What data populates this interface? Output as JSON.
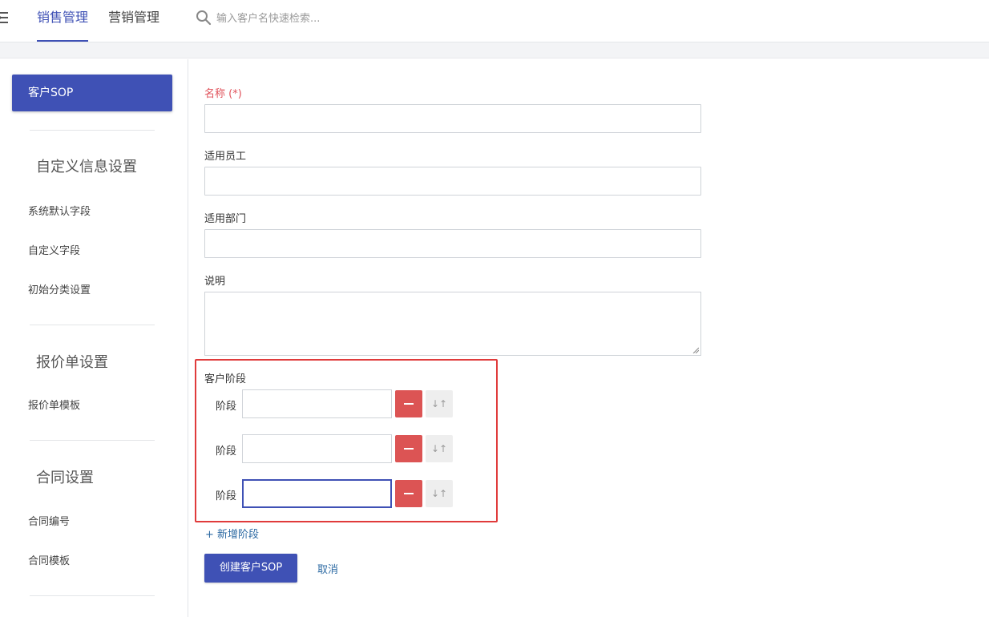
{
  "topbar": {
    "tabs": [
      {
        "label": "销售管理",
        "active": true
      },
      {
        "label": "营销管理",
        "active": false
      }
    ],
    "search": {
      "placeholder": "输入客户名快速检索..."
    }
  },
  "sidebar": {
    "active_item": "客户SOP",
    "sections": [
      {
        "heading": "自定义信息设置",
        "items": [
          "系统默认字段",
          "自定义字段",
          "初始分类设置"
        ]
      },
      {
        "heading": "报价单设置",
        "items": [
          "报价单模板"
        ]
      },
      {
        "heading": "合同设置",
        "items": [
          "合同编号",
          "合同模板"
        ]
      }
    ]
  },
  "form": {
    "name_label": "名称 (*)",
    "staff_label": "适用员工",
    "department_label": "适用部门",
    "description_label": "说明",
    "stages_title": "客户阶段",
    "stages": [
      {
        "label": "阶段",
        "value": ""
      },
      {
        "label": "阶段",
        "value": ""
      },
      {
        "label": "阶段",
        "value": ""
      }
    ],
    "sort_glyph": "↓↑",
    "add_stage_label": "+ 新增阶段",
    "submit_label": "创建客户SOP",
    "cancel_label": "取消"
  },
  "colors": {
    "accent": "#3f51b5",
    "danger": "#dc5454",
    "highlight_border": "#e03b3b",
    "link": "#2d6aa3",
    "required": "#e0525b"
  },
  "icons": [
    "menu-toggle-icon",
    "search-icon",
    "minus-icon",
    "sort-icon"
  ]
}
